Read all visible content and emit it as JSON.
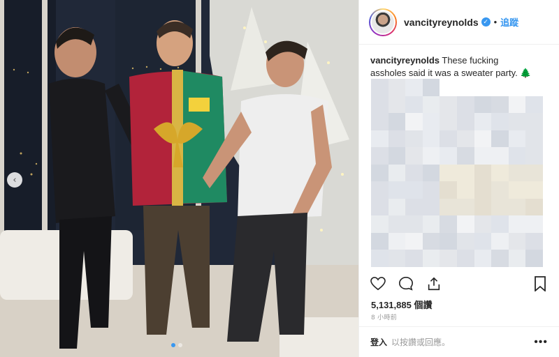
{
  "post": {
    "username": "vancityreynolds",
    "verified": true,
    "separator": "•",
    "follow_label": "追蹤",
    "caption_user": "vancityreynolds",
    "caption_text": "These fucking assholes said it was a sweater party.",
    "caption_emoji": "🌲",
    "likes_count": "5,131,885",
    "likes_label": "個讚",
    "time_ago": "8 小時前",
    "login_label": "登入",
    "login_prompt": "以按讚或回應。",
    "more_label": "•••",
    "carousel": {
      "slide_count": 2,
      "active_index": 0,
      "prev_glyph": "‹"
    }
  },
  "icons": {
    "like": "heart-icon",
    "comment": "comment-icon",
    "share": "share-icon",
    "save": "bookmark-icon",
    "verified": "verified-badge-icon"
  },
  "colors": {
    "accent": "#3897f0",
    "text": "#262626",
    "muted": "#999999",
    "border": "#efefef"
  }
}
